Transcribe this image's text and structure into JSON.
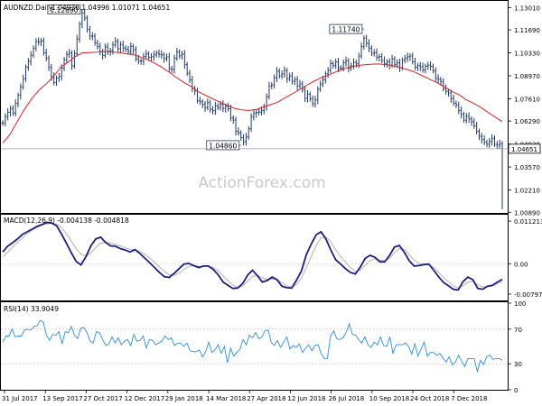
{
  "chart_data": {
    "type": "line",
    "title": "AUDNZD.Daily",
    "ohlc_text": "1.04936 1.04996 1.01071 1.04651",
    "watermark": "ActionForex.com",
    "x_ticks": [
      "31 Jul 2017",
      "13 Sep 2017",
      "27 Oct 2017",
      "12 Dec 2017",
      "29 Jan 2018",
      "14 Mar 2018",
      "27 Apr 2018",
      "12 Jun 2018",
      "26 Jul 2018",
      "10 Sep 2018",
      "24 Oct 2018",
      "7 Dec 2018"
    ],
    "price": {
      "ylim": [
        1.0085,
        1.1335
      ],
      "y_ticks": [
        "1.13010",
        "1.11690",
        "1.10330",
        "1.08970",
        "1.07610",
        "1.06290",
        "1.04930",
        "1.03570",
        "1.02210",
        "1.00890"
      ],
      "y_tick_values": [
        1.1301,
        1.1169,
        1.1033,
        1.0897,
        1.0761,
        1.0629,
        1.0493,
        1.0357,
        1.0221,
        1.0089
      ],
      "last_label": "1.04651",
      "last_value": 1.04651,
      "close_series": [
        1.0617,
        1.0655,
        1.0681,
        1.0703,
        1.0676,
        1.0733,
        1.0781,
        1.0831,
        1.088,
        1.0948,
        1.0983,
        1.1019,
        1.1061,
        1.11,
        1.1098,
        1.1104,
        1.1033,
        1.1002,
        1.0947,
        1.0893,
        1.0857,
        1.0883,
        1.0893,
        1.0941,
        1.0992,
        1.1024,
        1.1032,
        1.0956,
        1.1029,
        1.1115,
        1.1203,
        1.1269,
        1.1239,
        1.1171,
        1.1132,
        1.1132,
        1.1091,
        1.107,
        1.104,
        1.1018,
        1.1068,
        1.1039,
        1.1047,
        1.108,
        1.1101,
        1.1057,
        1.1081,
        1.1062,
        1.1053,
        1.1041,
        1.1071,
        1.1051,
        1.0997,
        1.0984,
        1.0985,
        1.1012,
        1.1026,
        1.1006,
        1.101,
        1.1021,
        1.1032,
        1.1024,
        1.102,
        1.0999,
        1.1009,
        1.094,
        1.0935,
        1.1001,
        1.1038,
        1.1015,
        1.1025,
        1.0963,
        1.0912,
        1.0873,
        1.0822,
        1.0807,
        1.0749,
        1.0743,
        1.0727,
        1.0708,
        1.0738,
        1.0698,
        1.069,
        1.0719,
        1.071,
        1.0728,
        1.0704,
        1.0716,
        1.0702,
        1.0647,
        1.0635,
        1.0568,
        1.0559,
        1.0531,
        1.0507,
        1.0535,
        1.0583,
        1.0655,
        1.0674,
        1.068,
        1.0682,
        1.0691,
        1.0715,
        1.0773,
        1.0837,
        1.0843,
        1.0885,
        1.0925,
        1.0896,
        1.0908,
        1.0928,
        1.088,
        1.0895,
        1.0864,
        1.0875,
        1.0837,
        1.0849,
        1.0817,
        1.0764,
        1.0788,
        1.076,
        1.0731,
        1.0754,
        1.0818,
        1.0849,
        1.0873,
        1.0909,
        1.0929,
        1.0969,
        1.0959,
        1.0979,
        1.0944,
        1.0942,
        1.0974,
        1.0986,
        1.0942,
        1.0955,
        1.0976,
        1.0968,
        1.1014,
        1.107,
        1.112,
        1.1089,
        1.1061,
        1.103,
        1.1035,
        1.1007,
        1.1011,
        1.0988,
        1.0968,
        1.098,
        1.096,
        1.0997,
        1.0965,
        1.0974,
        1.0944,
        1.099,
        1.1001,
        1.101,
        1.1014,
        1.098,
        1.0948,
        1.0958,
        1.095,
        1.0931,
        1.0953,
        1.096,
        1.0953,
        1.0927,
        1.0882,
        1.0875,
        1.0863,
        1.0821,
        1.0805,
        1.0795,
        1.0762,
        1.0735,
        1.0724,
        1.0692,
        1.0669,
        1.0634,
        1.0657,
        1.0641,
        1.0626,
        1.06,
        1.0568,
        1.0539,
        1.0521,
        1.0503,
        1.0492,
        1.0508,
        1.0527,
        1.0491,
        1.0486,
        1.0494,
        1.0465
      ],
      "ma_series": [
        1.05,
        1.0549,
        1.0625,
        1.0698,
        1.0762,
        1.0812,
        1.0849,
        1.0892,
        1.0947,
        1.0976,
        1.1011,
        1.1033,
        1.1035,
        1.1037,
        1.1041,
        1.1039,
        1.1034,
        1.1028,
        1.1023,
        1.1008,
        1.0992,
        1.0971,
        1.0947,
        1.0918,
        1.0887,
        1.0858,
        1.0834,
        1.0803,
        1.0782,
        1.0761,
        1.0741,
        1.0723,
        1.0704,
        1.0695,
        1.0692,
        1.0697,
        1.0712,
        1.0726,
        1.0741,
        1.0767,
        1.079,
        1.0816,
        1.0841,
        1.0865,
        1.0886,
        1.0902,
        1.092,
        1.0937,
        1.095,
        1.0958,
        1.0962,
        1.0966,
        1.0967,
        1.0963,
        1.0956,
        1.0946,
        1.0932,
        1.0917,
        1.0897,
        1.0876,
        1.0856,
        1.0833,
        1.0805,
        1.0786,
        1.0756,
        1.0735,
        1.0711,
        1.0681,
        1.0653,
        1.0626
      ],
      "annotations": [
        {
          "label": "1.12890",
          "value": 1.1289,
          "bar": 31
        },
        {
          "label": "1.04860",
          "value": 1.0486,
          "bar": 93
        },
        {
          "label": "1.11740",
          "value": 1.1174,
          "bar": 141
        }
      ],
      "final_spike_low": 1.01071
    },
    "macd": {
      "label": "MACD(12,26,9) -0.004138 -0.004818",
      "ylim": [
        -0.00965,
        0.01265
      ],
      "y_ticks": [
        "0.011213",
        "0.00",
        "-0.007972"
      ],
      "y_tick_values": [
        0.011213,
        0.0,
        -0.007972
      ],
      "macd_series": [
        0.0031,
        0.0046,
        0.0055,
        0.0065,
        0.0077,
        0.0084,
        0.0091,
        0.0098,
        0.0103,
        0.0109,
        0.0107,
        0.01,
        0.0078,
        0.0054,
        0.0029,
        0.0006,
        -0.0003,
        0.0019,
        0.0047,
        0.0065,
        0.007,
        0.0056,
        0.0047,
        0.0046,
        0.004,
        0.0036,
        0.0031,
        0.0037,
        0.0027,
        0.0015,
        0.0003,
        -0.001,
        -0.0023,
        -0.0034,
        -0.0036,
        -0.0025,
        -0.0013,
        -0.0001,
        0.0001,
        -0.0005,
        -0.001,
        -0.0006,
        -0.0006,
        -0.0015,
        -0.0029,
        -0.0048,
        -0.0057,
        -0.0065,
        -0.0064,
        -0.0052,
        -0.003,
        -0.0017,
        -0.0031,
        -0.0048,
        -0.0044,
        -0.0035,
        -0.0042,
        -0.0059,
        -0.0063,
        -0.0064,
        -0.0043,
        -0.0019,
        0.0024,
        0.0052,
        0.0076,
        0.0084,
        0.0065,
        0.0036,
        0.001,
        -0.0001,
        -0.0013,
        -0.0023,
        -0.0027,
        -0.0009,
        0.0014,
        0.0022,
        0.0017,
        0.0005,
        0.0005,
        0.0022,
        0.0044,
        0.0048,
        0.003,
        0.0008,
        -0.0006,
        -0.0005,
        -0.0002,
        -0.0001,
        -0.0017,
        -0.0034,
        -0.0049,
        -0.0058,
        -0.0067,
        -0.0069,
        -0.0047,
        -0.0035,
        -0.0042,
        -0.0065,
        -0.0067,
        -0.0059,
        -0.0057,
        -0.0048,
        -0.0041
      ],
      "signal_series": [
        0.0018,
        0.003,
        0.0044,
        0.0056,
        0.0068,
        0.0079,
        0.0088,
        0.0096,
        0.0102,
        0.0105,
        0.0106,
        0.0104,
        0.0095,
        0.0079,
        0.006,
        0.004,
        0.0025,
        0.002,
        0.0028,
        0.0042,
        0.0054,
        0.0057,
        0.0054,
        0.0051,
        0.0047,
        0.0042,
        0.0038,
        0.0036,
        0.0033,
        0.0025,
        0.0015,
        0.0004,
        -0.0008,
        -0.002,
        -0.0029,
        -0.003,
        -0.0025,
        -0.0015,
        -0.0007,
        -0.0005,
        -0.0007,
        -0.0007,
        -0.0007,
        -0.001,
        -0.0018,
        -0.0032,
        -0.0045,
        -0.0056,
        -0.0062,
        -0.0059,
        -0.0046,
        -0.0033,
        -0.003,
        -0.0037,
        -0.0041,
        -0.004,
        -0.0041,
        -0.005,
        -0.0058,
        -0.0062,
        -0.0054,
        -0.0038,
        -0.001,
        0.002,
        0.0048,
        0.0068,
        0.007,
        0.0058,
        0.0036,
        0.0019,
        0.0004,
        -0.001,
        -0.002,
        -0.0017,
        -0.0004,
        0.0008,
        0.0013,
        0.001,
        0.0008,
        0.0014,
        0.0029,
        0.004,
        0.0038,
        0.0024,
        0.001,
        0.0001,
        -0.0002,
        -0.0002,
        -0.001,
        -0.0022,
        -0.0036,
        -0.0047,
        -0.0058,
        -0.0064,
        -0.0058,
        -0.0048,
        -0.0046,
        -0.0055,
        -0.0061,
        -0.006,
        -0.0058,
        -0.0052,
        -0.0047
      ]
    },
    "rsi": {
      "label": "RSI(14) 33.9049",
      "ylim": [
        0,
        100
      ],
      "y_ticks": [
        "100",
        "70",
        "30",
        "0"
      ],
      "y_tick_values": [
        100,
        70,
        30,
        0
      ],
      "rsi_series": [
        55,
        62,
        62,
        70,
        61,
        62,
        62,
        69,
        70,
        69,
        73,
        74,
        80,
        78,
        63,
        57,
        64,
        63,
        67,
        53,
        67,
        66,
        73,
        63,
        59,
        71,
        72,
        66,
        56,
        54,
        67,
        66,
        58,
        51,
        53,
        61,
        54,
        60,
        52,
        56,
        58,
        51,
        64,
        56,
        57,
        62,
        48,
        58,
        57,
        52,
        54,
        56,
        62,
        58,
        60,
        51,
        54,
        54,
        50,
        54,
        45,
        44,
        44,
        46,
        38,
        44,
        55,
        43,
        46,
        52,
        42,
        50,
        31,
        48,
        39,
        43,
        47,
        58,
        52,
        63,
        60,
        66,
        59,
        61,
        68,
        69,
        55,
        51,
        57,
        49,
        55,
        61,
        47,
        51,
        49,
        53,
        43,
        48,
        52,
        45,
        51,
        52,
        42,
        36,
        36,
        62,
        68,
        59,
        58,
        60,
        66,
        76,
        64,
        63,
        58,
        54,
        61,
        52,
        49,
        55,
        52,
        61,
        51,
        50,
        61,
        42,
        52,
        52,
        52,
        54,
        50,
        41,
        53,
        39,
        47,
        55,
        39,
        43,
        43,
        40,
        42,
        37,
        32,
        38,
        29,
        32,
        40,
        33,
        27,
        36,
        36,
        36,
        21,
        34,
        29,
        38,
        40,
        35,
        36,
        36,
        34
      ]
    }
  }
}
